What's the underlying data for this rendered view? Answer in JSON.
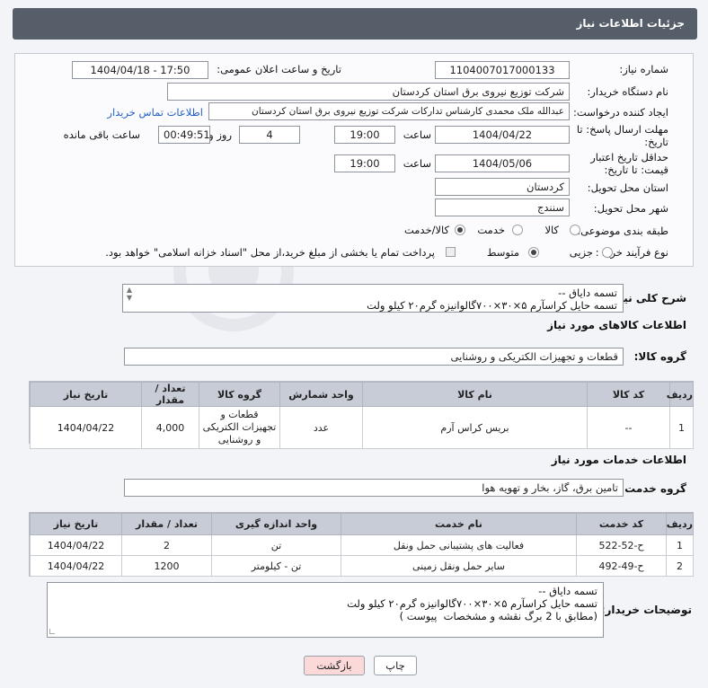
{
  "header": {
    "title": "جزئیات اطلاعات نیاز"
  },
  "form": {
    "need_number_label": "شماره نیاز:",
    "need_number": "1104007017000133",
    "announce_label": "تاریخ و ساعت اعلان عمومی:",
    "announce_value": "1404/04/18 - 17:50",
    "buyer_org_label": "نام دستگاه خریدار:",
    "buyer_org": "شرکت توزیع نیروی برق استان کردستان",
    "creator_label": "ایجاد کننده درخواست:",
    "creator": "عبدالله ملک محمدی کارشناس تدارکات شرکت توزیع نیروی برق استان کردستان",
    "contact_link": "اطلاعات تماس خریدار",
    "deadline_label": "مهلت ارسال پاسخ: تا تاریخ:",
    "deadline_date": "1404/04/22",
    "time_label": "ساعت",
    "deadline_time": "19:00",
    "days_value": "4",
    "days_label": "روز و",
    "remaining_value": "00:49:51",
    "remaining_label": "ساعت باقی مانده",
    "validity_label": "حداقل تاریخ اعتبار قیمت: تا تاریخ:",
    "validity_date": "1404/05/06",
    "validity_time": "19:00",
    "province_label": "استان محل تحویل:",
    "province": "کردستان",
    "city_label": "شهر محل تحویل:",
    "city": "سنندج",
    "category_label": "طبقه بندی موضوعی:",
    "category_options": [
      "کالا",
      "خدمت",
      "کالا/خدمت"
    ],
    "process_label": "نوع فرآیند خرید :",
    "process_options": [
      "جزیی",
      "متوسط"
    ],
    "payment_note": "پرداخت تمام یا بخشی از مبلغ خرید،از محل \"اسناد خزانه اسلامی\" خواهد بود."
  },
  "description": {
    "label": "شرح کلی نیاز:",
    "text": "تسمه دایاق --\nتسمه حایل کراسآرم ۵×۳۰×۷۰۰گالوانیزه گرم۲۰ کیلو ولت"
  },
  "goods": {
    "section_title": "اطلاعات کالاهای مورد نیاز",
    "group_label": "گروه کالا:",
    "group_value": "قطعات و تجهیزات الکتریکی و روشنایی",
    "columns": [
      "ردیف",
      "کد کالا",
      "نام کالا",
      "واحد شمارش",
      "گروه کالا",
      "تعداد / مقدار",
      "تاریخ نیاز"
    ],
    "rows": [
      {
        "row": "1",
        "code": "--",
        "name": "بریس کراس آرم",
        "unit": "عدد",
        "group": "قطعات و تجهیزات الکتریکی و روشنایی",
        "qty": "4,000",
        "date": "1404/04/22"
      }
    ]
  },
  "services": {
    "section_title": "اطلاعات خدمات مورد نیاز",
    "group_label": "گروه خدمت:",
    "group_value": "تامین برق، گاز، بخار و تهویه هوا",
    "columns": [
      "ردیف",
      "کد خدمت",
      "نام خدمت",
      "واحد اندازه گیری",
      "تعداد / مقدار",
      "تاریخ نیاز"
    ],
    "rows": [
      {
        "row": "1",
        "code": "ح-52-522",
        "name": "فعالیت های پشتیبانی حمل ونقل",
        "unit": "تن",
        "qty": "2",
        "date": "1404/04/22"
      },
      {
        "row": "2",
        "code": "ح-49-492",
        "name": "سایر حمل ونقل زمینی",
        "unit": "تن - کیلومتر",
        "qty": "1200",
        "date": "1404/04/22"
      }
    ]
  },
  "buyer_notes": {
    "label": "توضیحات خریدار:",
    "text": "تسمه دایاق --\nتسمه حایل کراسآرم ۵×۳۰×۷۰۰گالوانیزه گرم۲۰ کیلو ولت\n(مطابق با 2 برگ نقشه و مشخصات  پیوست )"
  },
  "buttons": {
    "print": "چاپ",
    "back": "بازگشت"
  },
  "colors": {
    "header_bg": "#565e69",
    "table_header_bg": "#c8ccd6",
    "link": "#2461c4",
    "back_button_bg": "#fbd9d9"
  }
}
